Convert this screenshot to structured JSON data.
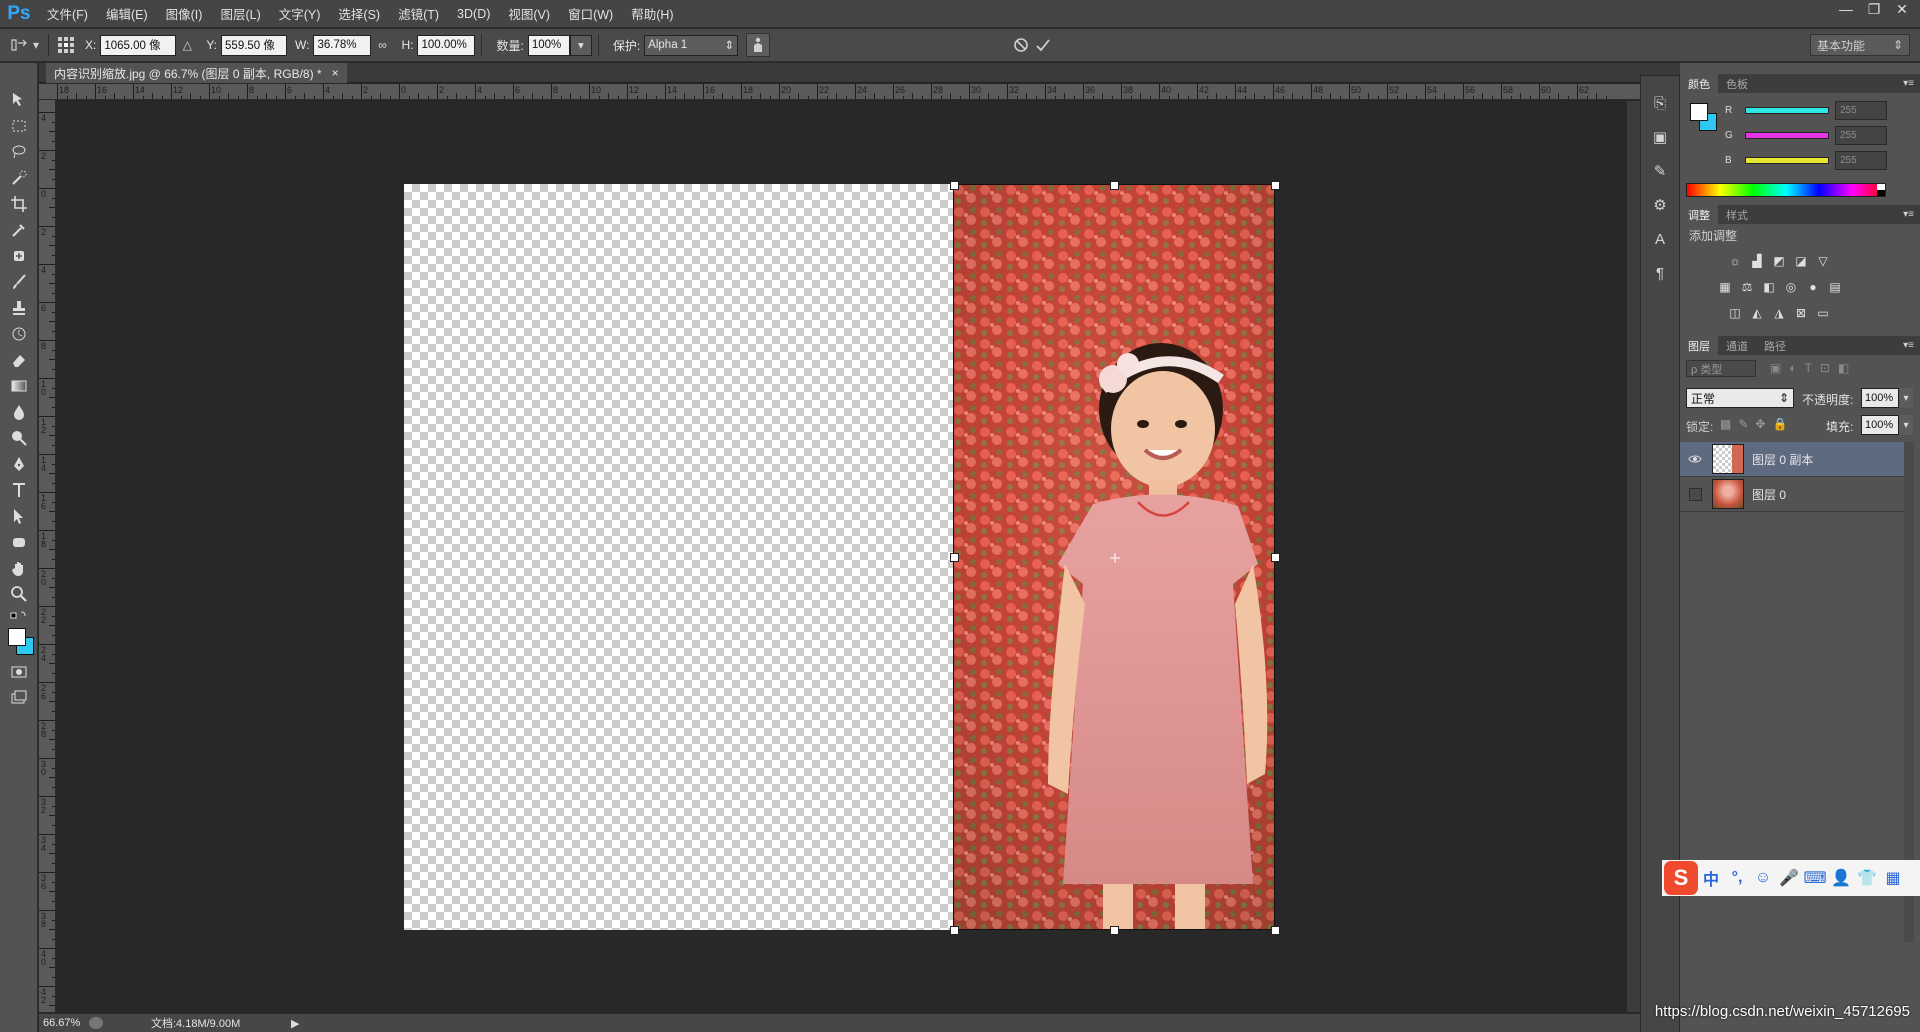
{
  "app": {
    "logo": "Ps"
  },
  "menu": [
    "文件(F)",
    "编辑(E)",
    "图像(I)",
    "图层(L)",
    "文字(Y)",
    "选择(S)",
    "滤镜(T)",
    "3D(D)",
    "视图(V)",
    "窗口(W)",
    "帮助(H)"
  ],
  "options": {
    "x_label": "X:",
    "x_value": "1065.00 像",
    "y_label": "Y:",
    "y_value": "559.50 像",
    "w_label": "W:",
    "w_value": "36.78%",
    "h_label": "H:",
    "h_value": "100.00%",
    "amount_label": "数量:",
    "amount_value": "100%",
    "protect_label": "保护:",
    "protect_value": "Alpha 1",
    "workspace": "基本功能"
  },
  "document": {
    "tab_title": "内容识别缩放.jpg @ 66.7% (图层 0 副本, RGB/8) *",
    "close": "×"
  },
  "ruler": {
    "top": [
      "18",
      "16",
      "14",
      "12",
      "10",
      "8",
      "6",
      "4",
      "2",
      "0",
      "2",
      "4",
      "6",
      "8",
      "10",
      "12",
      "14",
      "16",
      "18",
      "20",
      "22",
      "24",
      "26",
      "28",
      "30",
      "32",
      "34",
      "36",
      "38",
      "40",
      "42",
      "44",
      "46",
      "48",
      "50",
      "52",
      "54",
      "56",
      "58",
      "60",
      "62"
    ],
    "left": [
      "4",
      "2",
      "0",
      "2",
      "4",
      "6",
      "8",
      "10",
      "12",
      "14",
      "16",
      "18",
      "20",
      "22",
      "24",
      "26",
      "28",
      "30",
      "32",
      "34",
      "36",
      "38",
      "40",
      "42"
    ]
  },
  "status": {
    "zoom": "66.67%",
    "doc_info": "文档:4.18M/9.00M"
  },
  "color_panel": {
    "tabs": [
      "颜色",
      "色板"
    ],
    "channels": [
      {
        "label": "R",
        "value": "255"
      },
      {
        "label": "G",
        "value": "255"
      },
      {
        "label": "B",
        "value": "255"
      }
    ],
    "channel_colors": {
      "r": "#2ee6e6",
      "g": "#e633e6",
      "b": "#e6e633"
    }
  },
  "adjustments_panel": {
    "tabs": [
      "调整",
      "样式"
    ],
    "title": "添加调整"
  },
  "layers_panel": {
    "tabs": [
      "图层",
      "通道",
      "路径"
    ],
    "filter": "ρ 类型",
    "blend_mode": "正常",
    "opacity_label": "不透明度:",
    "opacity_value": "100%",
    "lock_label": "锁定:",
    "fill_label": "填充:",
    "fill_value": "100%",
    "layers": [
      {
        "name": "图层 0 副本",
        "visible": true,
        "selected": true
      },
      {
        "name": "图层 0",
        "visible": false,
        "selected": false
      }
    ]
  },
  "ime": {
    "items": [
      "中",
      "°,",
      "☺",
      "🎤",
      "⌨",
      "👤",
      "👕",
      "▦"
    ]
  },
  "watermark": "https://blog.csdn.net/weixin_45712695"
}
